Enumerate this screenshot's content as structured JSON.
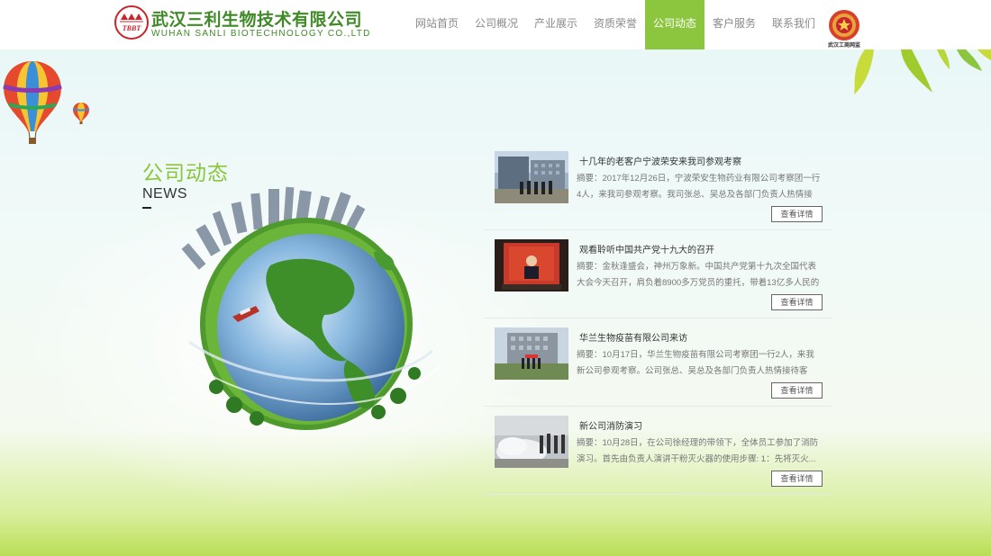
{
  "header": {
    "logo_mark": "TBBT",
    "company_cn": "武汉三利生物技术有限公司",
    "company_en": "WUHAN SANLI BIOTECHNOLOGY CO.,LTD",
    "badge_text": "武汉工商网监"
  },
  "nav": {
    "items": [
      {
        "label": "网站首页",
        "active": false
      },
      {
        "label": "公司概况",
        "active": false
      },
      {
        "label": "产业展示",
        "active": false
      },
      {
        "label": "资质荣誉",
        "active": false
      },
      {
        "label": "公司动态",
        "active": true
      },
      {
        "label": "客户服务",
        "active": false
      },
      {
        "label": "联系我们",
        "active": false
      }
    ]
  },
  "section": {
    "title": "公司动态",
    "subtitle": "NEWS"
  },
  "news": [
    {
      "title": "十几年的老客户宁波荣安来我司参观考察",
      "summary": "摘要：2017年12月26日，宁波荣安生物药业有限公司考察团一行4人，来我司参观考察。我司张总、吴总及各部门负责人热情接待...",
      "button": "查看详情"
    },
    {
      "title": "观看聆听中国共产党十九大的召开",
      "summary": "摘要：金秋逢盛会，神州万象新。中国共产党第十九次全国代表大会今天召开，肩负着8900多万党员的重托，带着13亿多人民的期...",
      "button": "查看详情"
    },
    {
      "title": "华兰生物疫苗有限公司来访",
      "summary": "摘要：10月17日，华兰生物疫苗有限公司考察团一行2人，来我新公司参观考察。公司张总、吴总及各部门负责人热情接待客人。...",
      "button": "查看详情"
    },
    {
      "title": "新公司消防演习",
      "summary": "摘要：10月28日，在公司徐经理的带领下，全体员工参加了消防演习。首先由负责人演讲干粉灭火器的使用步骤:        1：先将灭火...",
      "button": "查看详情"
    }
  ],
  "colors": {
    "brand_green": "#3f8a27",
    "accent_green": "#8cc63f",
    "logo_red": "#c8262d"
  }
}
